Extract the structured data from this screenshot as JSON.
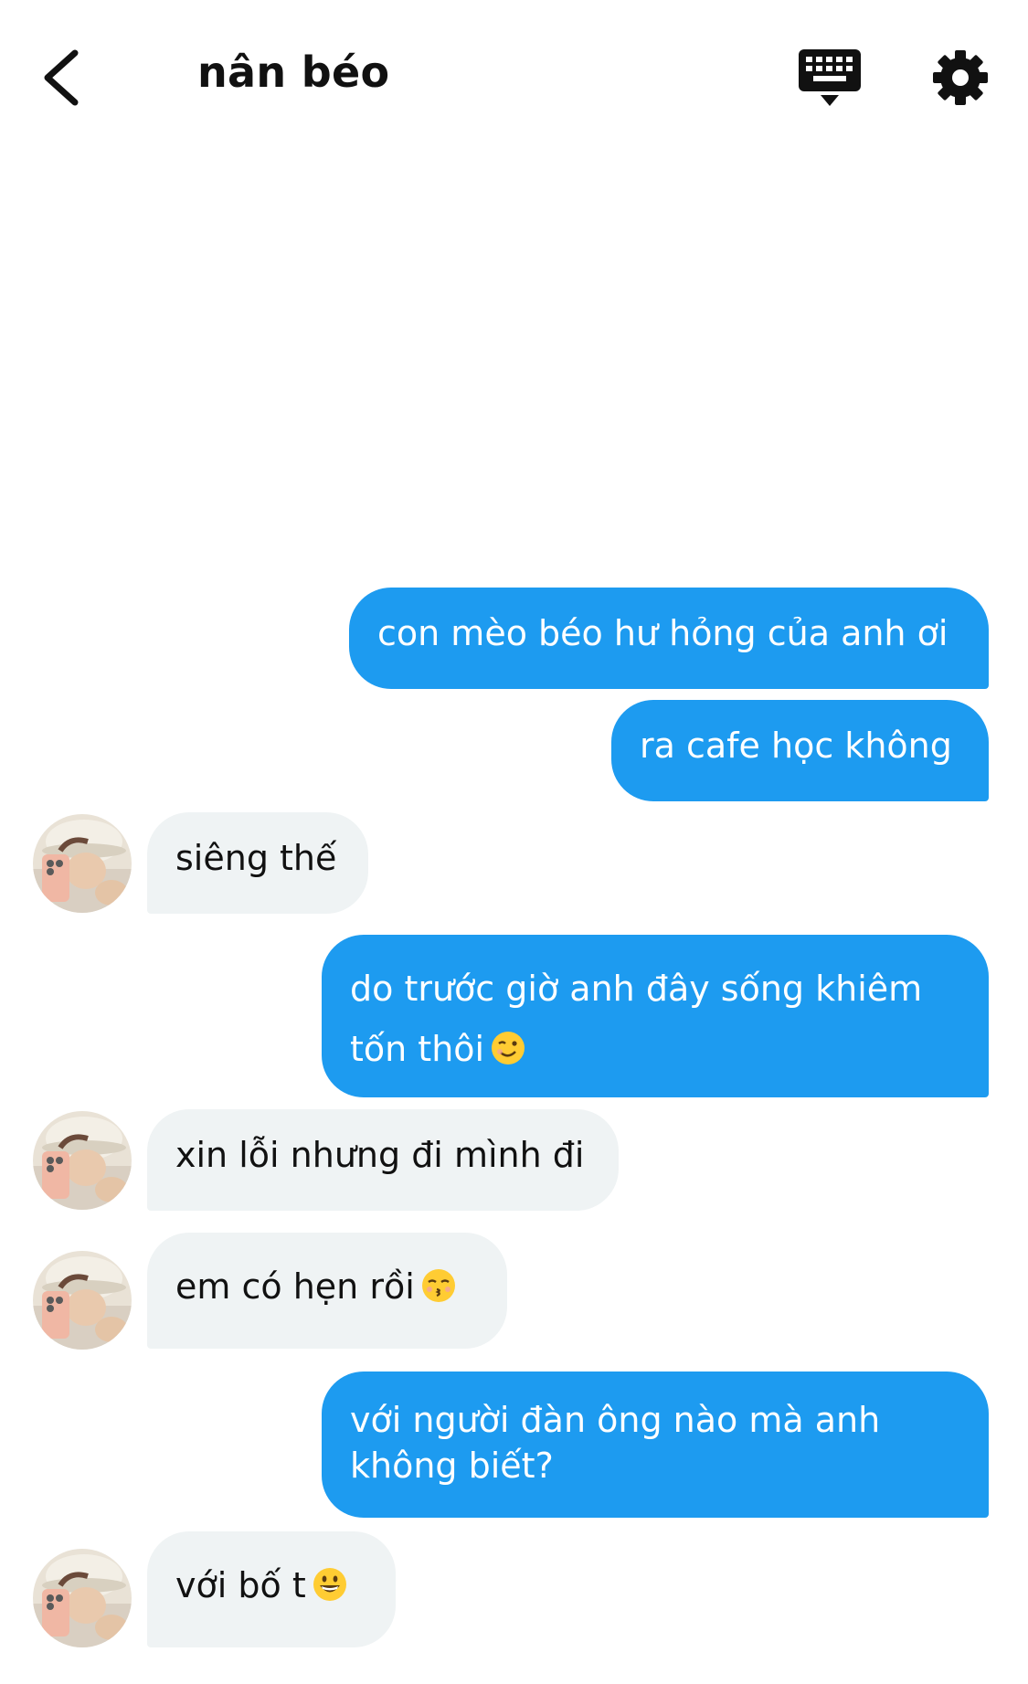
{
  "header": {
    "title": "nân béo",
    "back_icon": "chevron-left-icon",
    "keyboard_icon": "keyboard-icon",
    "settings_icon": "gear-icon"
  },
  "colors": {
    "sent_bubble": "#1d9bf0",
    "received_bubble": "#eff3f4"
  },
  "messages": [
    {
      "sender": "me",
      "lines": [
        "con mèo béo hư hỏng của anh ơi"
      ]
    },
    {
      "sender": "me",
      "lines": [
        "ra cafe học không"
      ]
    },
    {
      "sender": "them",
      "lines": [
        "siêng thế"
      ]
    },
    {
      "sender": "me",
      "lines": [
        "do trước giờ anh đây sống khiêm",
        "tốn thôi"
      ],
      "emoji": "winking-face-emoji"
    },
    {
      "sender": "them",
      "lines": [
        "xin lỗi nhưng đi mình đi"
      ]
    },
    {
      "sender": "them",
      "lines": [
        "em có hẹn rồi"
      ],
      "emoji": "kissing-face-emoji"
    },
    {
      "sender": "me",
      "lines": [
        "với người đàn ông nào mà anh",
        "không biết?"
      ]
    },
    {
      "sender": "them",
      "lines": [
        "với bố t"
      ],
      "emoji": "grinning-face-emoji"
    }
  ]
}
